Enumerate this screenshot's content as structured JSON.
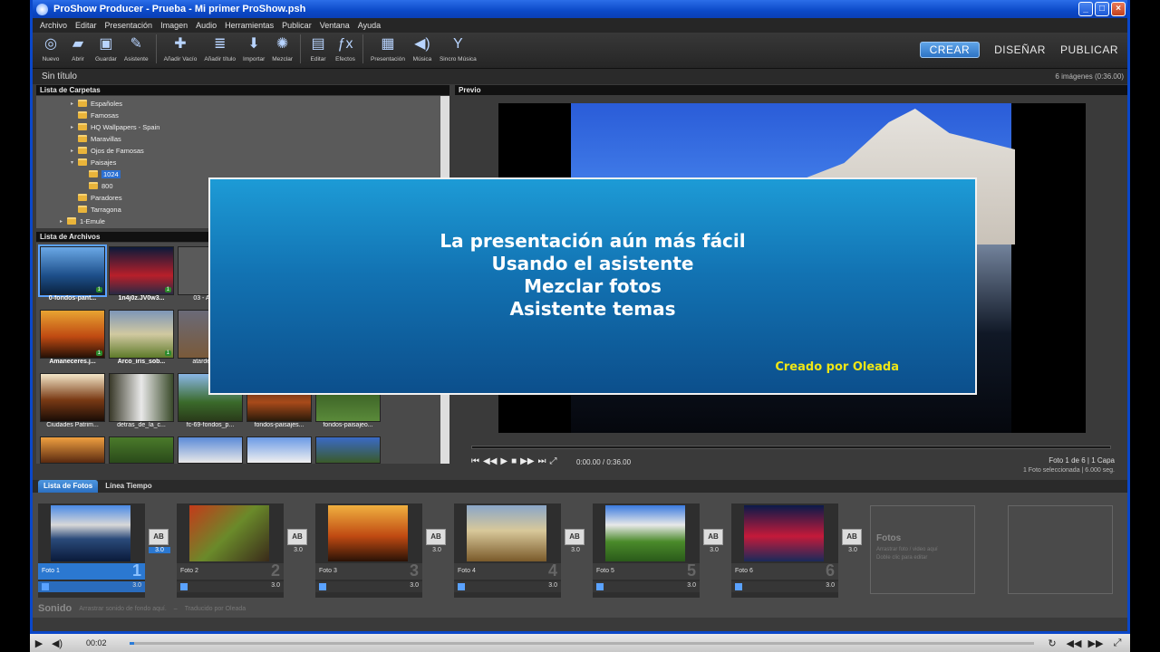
{
  "window": {
    "title": "ProShow Producer - Prueba - Mi primer ProShow.psh"
  },
  "menu": [
    "Archivo",
    "Editar",
    "Presentación",
    "Imagen",
    "Audio",
    "Herramientas",
    "Publicar",
    "Ventana",
    "Ayuda"
  ],
  "toolbar": {
    "items": [
      "Nuevo",
      "Abrir",
      "Guardar",
      "Asistente",
      "Añadir Vacío",
      "Añadir título",
      "Importar",
      "Mezclar",
      "Editar",
      "Efectos",
      "Presentación",
      "Música",
      "Sincro Música"
    ],
    "icons": [
      "disc-icon",
      "folder-open-icon",
      "save-icon",
      "wizard-icon",
      "add-blank-icon",
      "add-title-icon",
      "import-icon",
      "mix-icon",
      "edit-icon",
      "effects-icon",
      "show-icon",
      "music-icon",
      "sync-music-icon"
    ]
  },
  "modes": {
    "create": "CREAR",
    "design": "DISEÑAR",
    "publish": "PUBLICAR"
  },
  "show": {
    "name": "Sin título",
    "summary": "6 imágenes (0:36.00)"
  },
  "folders": {
    "header": "Lista de Carpetas",
    "items": [
      "Españoles",
      "Famosas",
      "HQ Wallpapers - Spain",
      "Maravillas",
      "Ojos de Famosas",
      "Paisajes",
      "1024",
      "800",
      "Paradores",
      "Tarragona",
      "1-Emule"
    ],
    "selected": "1024"
  },
  "files": {
    "header": "Lista de Archivos",
    "labels": [
      "0-fondos-pant...",
      "1n4j0z.JV0w3...",
      "03 - Alone...",
      "Amaneceres.j...",
      "Arco_iris_sob...",
      "atardecer_...",
      "Ciudades Patrim...",
      "detras_de_la_c...",
      "fc-69-fondos_p...",
      "fondos-paisajes...",
      "fondos-paisajeo..."
    ],
    "used_mark": "1"
  },
  "preview": {
    "header": "Previo",
    "time": "0:00.00 / 0:36.00",
    "frame_info": "Foto  1 de 6  |  1 Capa",
    "selection_info": "1 Foto seleccionada  |  6.000 seg."
  },
  "overlay": {
    "lines": [
      "La presentación aún más fácil",
      "Usando el asistente",
      "Mezclar fotos",
      "Asistente temas"
    ],
    "credit": "Creado por Oleada"
  },
  "tabs": {
    "photos": "Lista de Fotos",
    "timeline": "Línea Tiempo"
  },
  "slides": [
    {
      "label": "Foto 1",
      "num": "1",
      "dur": "3.0"
    },
    {
      "label": "Foto 2",
      "num": "2",
      "dur": "3.0"
    },
    {
      "label": "Foto 3",
      "num": "3",
      "dur": "3.0"
    },
    {
      "label": "Foto 4",
      "num": "4",
      "dur": "3.0"
    },
    {
      "label": "Foto 5",
      "num": "5",
      "dur": "3.0"
    },
    {
      "label": "Foto 6",
      "num": "6",
      "dur": "3.0"
    }
  ],
  "transition": {
    "icon": "AB",
    "dur": "3.0"
  },
  "drop": {
    "title": "Fotos",
    "line1": "Arrastrar foto / video aquí",
    "line2": "Doble clic para editar"
  },
  "sound": {
    "title": "Sonido",
    "hint": "Arrastrar sonido de fondo aquí.",
    "sep": "–",
    "credit": "Traducido por Oleada"
  },
  "player": {
    "time": "00:02",
    "progress_fraction": 0.005
  },
  "colors": {
    "accent": "#2b78d1",
    "titlebar": "#0b49c8",
    "card": "#1272b2",
    "credit": "#f0e616"
  }
}
